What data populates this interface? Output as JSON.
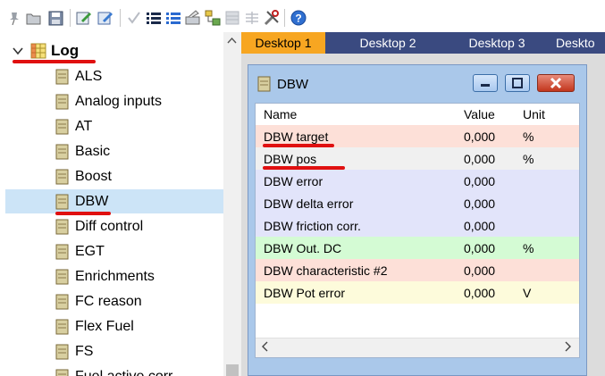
{
  "toolbar": {
    "icons": [
      "pin-icon",
      "open-folder-icon",
      "save-icon",
      "edit-icon",
      "edit-alt-icon",
      "check-icon",
      "list-icon",
      "list-alt-icon",
      "wand-icon",
      "tree-icon",
      "grid-icon",
      "columns-icon",
      "tools-icon",
      "help-icon"
    ]
  },
  "tree": {
    "root_label": "Log",
    "items": [
      {
        "label": "ALS"
      },
      {
        "label": "Analog inputs"
      },
      {
        "label": "AT"
      },
      {
        "label": "Basic"
      },
      {
        "label": "Boost"
      },
      {
        "label": "DBW",
        "selected": true
      },
      {
        "label": "Diff control"
      },
      {
        "label": "EGT"
      },
      {
        "label": "Enrichments"
      },
      {
        "label": "FC reason"
      },
      {
        "label": "Flex Fuel"
      },
      {
        "label": "FS"
      },
      {
        "label": "Fuel active corr."
      }
    ]
  },
  "tabs": [
    {
      "label": "Desktop 1",
      "active": true
    },
    {
      "label": "Desktop 2"
    },
    {
      "label": "Desktop 3"
    },
    {
      "label": "Deskto"
    }
  ],
  "window": {
    "title": "DBW",
    "columns": {
      "name": "Name",
      "value": "Value",
      "unit": "Unit"
    },
    "rows": [
      {
        "name": "DBW target",
        "value": "0,000",
        "unit": "%",
        "color": "#fde0d8"
      },
      {
        "name": "DBW pos",
        "value": "0,000",
        "unit": "%",
        "color": "#f0f0f0"
      },
      {
        "name": "DBW error",
        "value": "0,000",
        "unit": "",
        "color": "#e2e4fa"
      },
      {
        "name": "DBW delta error",
        "value": "0,000",
        "unit": "",
        "color": "#e2e4fa"
      },
      {
        "name": "DBW friction corr.",
        "value": "0,000",
        "unit": "",
        "color": "#e2e4fa"
      },
      {
        "name": "DBW Out. DC",
        "value": "0,000",
        "unit": "%",
        "color": "#d4fbd4"
      },
      {
        "name": "DBW characteristic #2",
        "value": "0,000",
        "unit": "",
        "color": "#fde0d8"
      },
      {
        "name": "DBW Pot error",
        "value": "0,000",
        "unit": "V",
        "color": "#fdfbdb"
      }
    ]
  },
  "colors": {
    "tab_bar": "#3a4a80",
    "tab_active": "#f7a621",
    "selection": "#cce4f7",
    "annotation_red": "#e01010"
  }
}
